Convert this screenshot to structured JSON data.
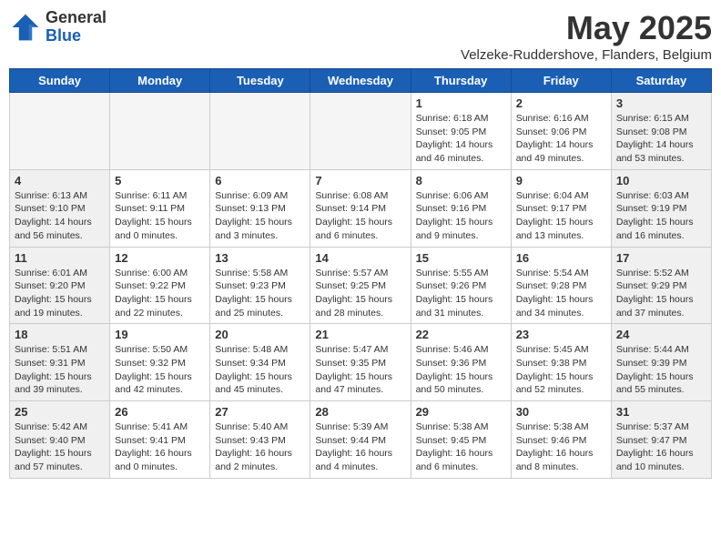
{
  "logo": {
    "general": "General",
    "blue": "Blue"
  },
  "title": "May 2025",
  "subtitle": "Velzeke-Ruddershove, Flanders, Belgium",
  "weekdays": [
    "Sunday",
    "Monday",
    "Tuesday",
    "Wednesday",
    "Thursday",
    "Friday",
    "Saturday"
  ],
  "weeks": [
    [
      {
        "num": "",
        "info": "",
        "empty": true
      },
      {
        "num": "",
        "info": "",
        "empty": true
      },
      {
        "num": "",
        "info": "",
        "empty": true
      },
      {
        "num": "",
        "info": "",
        "empty": true
      },
      {
        "num": "1",
        "info": "Sunrise: 6:18 AM\nSunset: 9:05 PM\nDaylight: 14 hours\nand 46 minutes."
      },
      {
        "num": "2",
        "info": "Sunrise: 6:16 AM\nSunset: 9:06 PM\nDaylight: 14 hours\nand 49 minutes."
      },
      {
        "num": "3",
        "info": "Sunrise: 6:15 AM\nSunset: 9:08 PM\nDaylight: 14 hours\nand 53 minutes."
      }
    ],
    [
      {
        "num": "4",
        "info": "Sunrise: 6:13 AM\nSunset: 9:10 PM\nDaylight: 14 hours\nand 56 minutes."
      },
      {
        "num": "5",
        "info": "Sunrise: 6:11 AM\nSunset: 9:11 PM\nDaylight: 15 hours\nand 0 minutes."
      },
      {
        "num": "6",
        "info": "Sunrise: 6:09 AM\nSunset: 9:13 PM\nDaylight: 15 hours\nand 3 minutes."
      },
      {
        "num": "7",
        "info": "Sunrise: 6:08 AM\nSunset: 9:14 PM\nDaylight: 15 hours\nand 6 minutes."
      },
      {
        "num": "8",
        "info": "Sunrise: 6:06 AM\nSunset: 9:16 PM\nDaylight: 15 hours\nand 9 minutes."
      },
      {
        "num": "9",
        "info": "Sunrise: 6:04 AM\nSunset: 9:17 PM\nDaylight: 15 hours\nand 13 minutes."
      },
      {
        "num": "10",
        "info": "Sunrise: 6:03 AM\nSunset: 9:19 PM\nDaylight: 15 hours\nand 16 minutes."
      }
    ],
    [
      {
        "num": "11",
        "info": "Sunrise: 6:01 AM\nSunset: 9:20 PM\nDaylight: 15 hours\nand 19 minutes."
      },
      {
        "num": "12",
        "info": "Sunrise: 6:00 AM\nSunset: 9:22 PM\nDaylight: 15 hours\nand 22 minutes."
      },
      {
        "num": "13",
        "info": "Sunrise: 5:58 AM\nSunset: 9:23 PM\nDaylight: 15 hours\nand 25 minutes."
      },
      {
        "num": "14",
        "info": "Sunrise: 5:57 AM\nSunset: 9:25 PM\nDaylight: 15 hours\nand 28 minutes."
      },
      {
        "num": "15",
        "info": "Sunrise: 5:55 AM\nSunset: 9:26 PM\nDaylight: 15 hours\nand 31 minutes."
      },
      {
        "num": "16",
        "info": "Sunrise: 5:54 AM\nSunset: 9:28 PM\nDaylight: 15 hours\nand 34 minutes."
      },
      {
        "num": "17",
        "info": "Sunrise: 5:52 AM\nSunset: 9:29 PM\nDaylight: 15 hours\nand 37 minutes."
      }
    ],
    [
      {
        "num": "18",
        "info": "Sunrise: 5:51 AM\nSunset: 9:31 PM\nDaylight: 15 hours\nand 39 minutes."
      },
      {
        "num": "19",
        "info": "Sunrise: 5:50 AM\nSunset: 9:32 PM\nDaylight: 15 hours\nand 42 minutes."
      },
      {
        "num": "20",
        "info": "Sunrise: 5:48 AM\nSunset: 9:34 PM\nDaylight: 15 hours\nand 45 minutes."
      },
      {
        "num": "21",
        "info": "Sunrise: 5:47 AM\nSunset: 9:35 PM\nDaylight: 15 hours\nand 47 minutes."
      },
      {
        "num": "22",
        "info": "Sunrise: 5:46 AM\nSunset: 9:36 PM\nDaylight: 15 hours\nand 50 minutes."
      },
      {
        "num": "23",
        "info": "Sunrise: 5:45 AM\nSunset: 9:38 PM\nDaylight: 15 hours\nand 52 minutes."
      },
      {
        "num": "24",
        "info": "Sunrise: 5:44 AM\nSunset: 9:39 PM\nDaylight: 15 hours\nand 55 minutes."
      }
    ],
    [
      {
        "num": "25",
        "info": "Sunrise: 5:42 AM\nSunset: 9:40 PM\nDaylight: 15 hours\nand 57 minutes."
      },
      {
        "num": "26",
        "info": "Sunrise: 5:41 AM\nSunset: 9:41 PM\nDaylight: 16 hours\nand 0 minutes."
      },
      {
        "num": "27",
        "info": "Sunrise: 5:40 AM\nSunset: 9:43 PM\nDaylight: 16 hours\nand 2 minutes."
      },
      {
        "num": "28",
        "info": "Sunrise: 5:39 AM\nSunset: 9:44 PM\nDaylight: 16 hours\nand 4 minutes."
      },
      {
        "num": "29",
        "info": "Sunrise: 5:38 AM\nSunset: 9:45 PM\nDaylight: 16 hours\nand 6 minutes."
      },
      {
        "num": "30",
        "info": "Sunrise: 5:38 AM\nSunset: 9:46 PM\nDaylight: 16 hours\nand 8 minutes."
      },
      {
        "num": "31",
        "info": "Sunrise: 5:37 AM\nSunset: 9:47 PM\nDaylight: 16 hours\nand 10 minutes."
      }
    ]
  ]
}
